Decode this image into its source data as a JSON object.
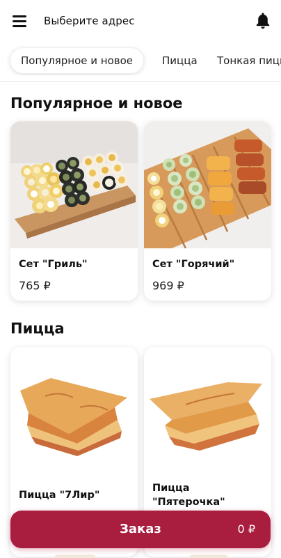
{
  "header": {
    "address_label": "Выберите адрес",
    "menu_icon": "hamburger-menu-icon",
    "bell_icon": "bell-icon"
  },
  "tabs": [
    {
      "label": "Популярное и новое",
      "active": true
    },
    {
      "label": "Пицца",
      "active": false
    },
    {
      "label": "Тонкая пицца",
      "active": false
    }
  ],
  "sections": [
    {
      "title": "Популярное и новое",
      "products": [
        {
          "name": "Сет \"Гриль\"",
          "price": "765 ₽"
        },
        {
          "name": "Сет \"Горячий\"",
          "price": "969 ₽"
        }
      ]
    },
    {
      "title": "Пицца",
      "products": [
        {
          "name": "Пицца \"7Лир\"",
          "price": ""
        },
        {
          "name": "Пицца \"Пятерочка\"",
          "price": ""
        }
      ]
    }
  ],
  "order": {
    "label": "Заказ",
    "total": "0 ₽",
    "color": "#a91d3f"
  }
}
